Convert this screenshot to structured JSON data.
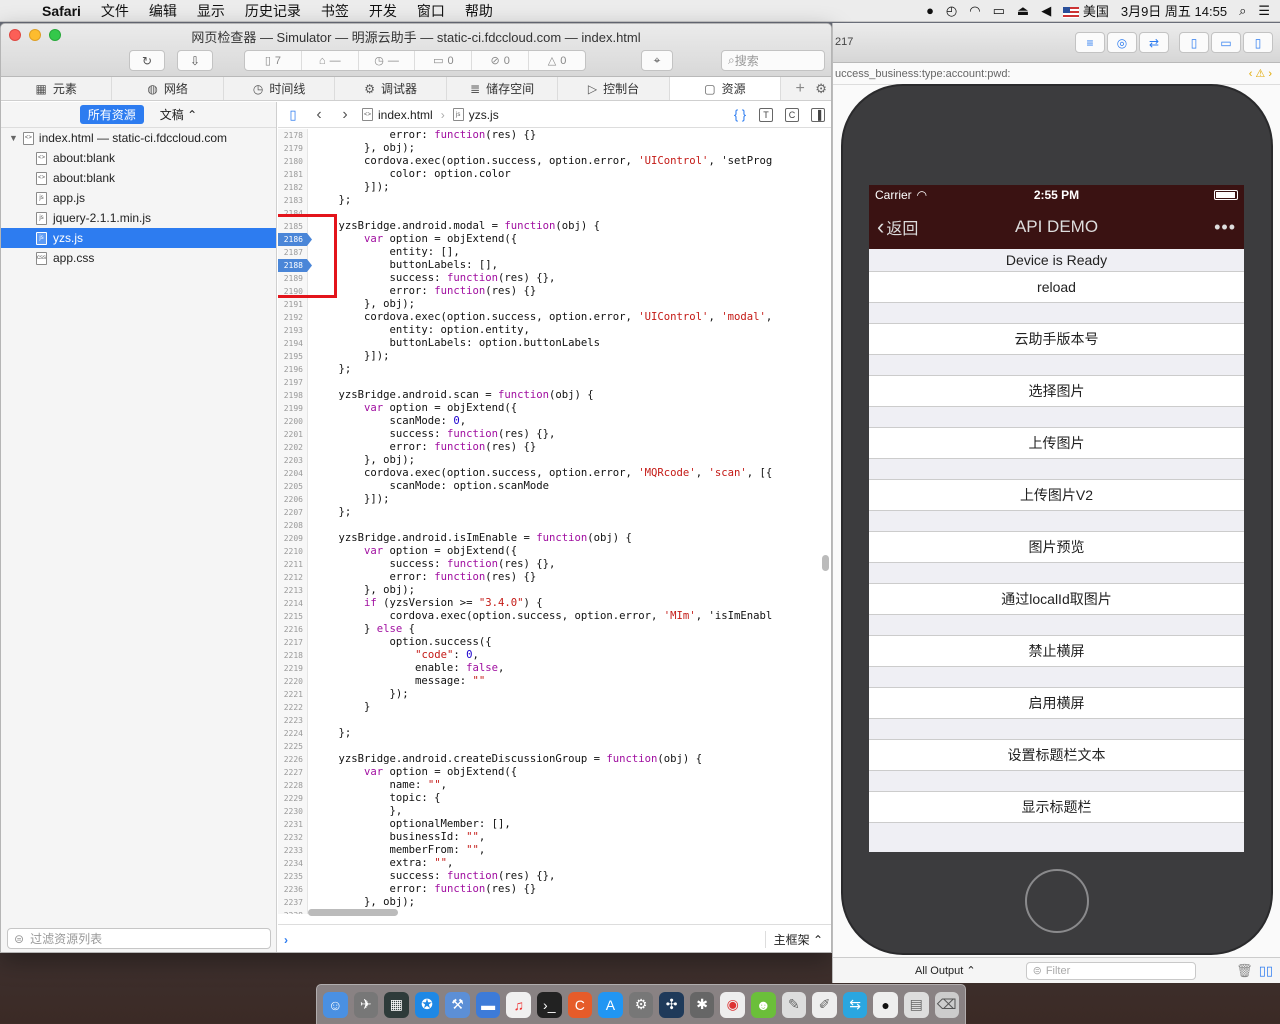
{
  "menubar": {
    "app": "Safari",
    "items": [
      "文件",
      "编辑",
      "显示",
      "历史记录",
      "书签",
      "开发",
      "窗口",
      "帮助"
    ],
    "input_source": "美国",
    "datetime": "3月9日 周五 14:55"
  },
  "inspector": {
    "window_title": "网页检查器 — Simulator — 明源云助手 — static-ci.fdccloud.com — index.html",
    "status": {
      "resources": "7",
      "logs": "—",
      "time": "—",
      "messages": "0",
      "errors": "0",
      "warnings": "0"
    },
    "search_placeholder": "搜索",
    "tabs": [
      {
        "label": "元素",
        "icon": "▦"
      },
      {
        "label": "网络",
        "icon": "◍"
      },
      {
        "label": "时间线",
        "icon": "◷"
      },
      {
        "label": "调试器",
        "icon": "⚙"
      },
      {
        "label": "储存空间",
        "icon": "≣"
      },
      {
        "label": "控制台",
        "icon": "▷"
      },
      {
        "label": "资源",
        "icon": "▢"
      }
    ],
    "sidebar": {
      "filter_all": "所有资源",
      "filter_doc": "文稿",
      "root": "index.html — static-ci.fdccloud.com",
      "items": [
        {
          "label": "about:blank",
          "icon": "<>"
        },
        {
          "label": "about:blank",
          "icon": "<>"
        },
        {
          "label": "app.js",
          "icon": "js"
        },
        {
          "label": "jquery-2.1.1.min.js",
          "icon": "js"
        },
        {
          "label": "yzs.js",
          "icon": "js"
        },
        {
          "label": "app.css",
          "icon": "css"
        }
      ],
      "filter_placeholder": "过滤资源列表"
    },
    "editor": {
      "breadcrumb_file": "index.html",
      "breadcrumb_script": "yzs.js",
      "breakpoint_lines": [
        "2186",
        "2188"
      ],
      "line_numbers": [
        "2178",
        "2179",
        "2180",
        "2181",
        "2182",
        "2183",
        "2184",
        "2185",
        "2186",
        "2187",
        "2188",
        "2189",
        "2190",
        "2191",
        "2192",
        "2193",
        "2194",
        "2195",
        "2196",
        "2197",
        "2198",
        "2199",
        "2200",
        "2201",
        "2202",
        "2203",
        "2204",
        "2205",
        "2206",
        "2207",
        "2208",
        "2209",
        "2210",
        "2211",
        "2212",
        "2213",
        "2214",
        "2215",
        "2216",
        "2217",
        "2218",
        "2219",
        "2220",
        "2221",
        "2222",
        "2223",
        "2224",
        "2225",
        "2226",
        "2227",
        "2228",
        "2229",
        "2230",
        "2231",
        "2232",
        "2233",
        "2234",
        "2235",
        "2236",
        "2237",
        "2238"
      ],
      "code_lines": [
        "            error: function(res) {}",
        "        }, obj);",
        "        cordova.exec(option.success, option.error, 'UIControl', 'setProg",
        "            color: option.color",
        "        }]);",
        "    };",
        "",
        "    yzsBridge.android.modal = function(obj) {",
        "        var option = objExtend({",
        "            entity: [],",
        "            buttonLabels: [],",
        "            success: function(res) {},",
        "            error: function(res) {}",
        "        }, obj);",
        "        cordova.exec(option.success, option.error, 'UIControl', 'modal',",
        "            entity: option.entity,",
        "            buttonLabels: option.buttonLabels",
        "        }]);",
        "    };",
        "",
        "    yzsBridge.android.scan = function(obj) {",
        "        var option = objExtend({",
        "            scanMode: 0,",
        "            success: function(res) {},",
        "            error: function(res) {}",
        "        }, obj);",
        "        cordova.exec(option.success, option.error, 'MQRcode', 'scan', [{",
        "            scanMode: option.scanMode",
        "        }]);",
        "    };",
        "",
        "    yzsBridge.android.isImEnable = function(obj) {",
        "        var option = objExtend({",
        "            success: function(res) {},",
        "            error: function(res) {}",
        "        }, obj);",
        "        if (yzsVersion >= \"3.4.0\") {",
        "            cordova.exec(option.success, option.error, 'MIm', 'isImEnabl",
        "        } else {",
        "            option.success({",
        "                \"code\": 0,",
        "                enable: false,",
        "                message: \"\"",
        "            });",
        "        }",
        "",
        "    };",
        "",
        "    yzsBridge.android.createDiscussionGroup = function(obj) {",
        "        var option = objExtend({",
        "            name: \"\",",
        "            topic: {",
        "            },",
        "            optionalMember: [],",
        "            businessId: \"\",",
        "            memberFrom: \"\",",
        "            extra: \"\",",
        "            success: function(res) {},",
        "            error: function(res) {}",
        "        }, obj);",
        ""
      ],
      "frame_label": "主框架"
    }
  },
  "xcode": {
    "toolbar_number": "217",
    "path_text": "uccess_business:type:account:pwd:",
    "output_label": "All Output",
    "filter_placeholder": "Filter"
  },
  "simulator": {
    "carrier": "Carrier",
    "time": "2:55 PM",
    "back_label": "返回",
    "title": "API DEMO",
    "more_icon": "•••",
    "ready_text": "Device is Ready",
    "buttons": [
      "reload",
      "云助手版本号",
      "选择图片",
      "上传图片",
      "上传图片V2",
      "图片预览",
      "通过localId取图片",
      "禁止横屏",
      "启用横屏",
      "设置标题栏文本",
      "显示标题栏"
    ]
  },
  "colors": {
    "selection_blue": "#2d7cf0",
    "highlight_red": "#e3141b",
    "nav_bar": "#3a1212",
    "keyword_purple": "#a00fa0",
    "string_red": "#c41a16"
  }
}
